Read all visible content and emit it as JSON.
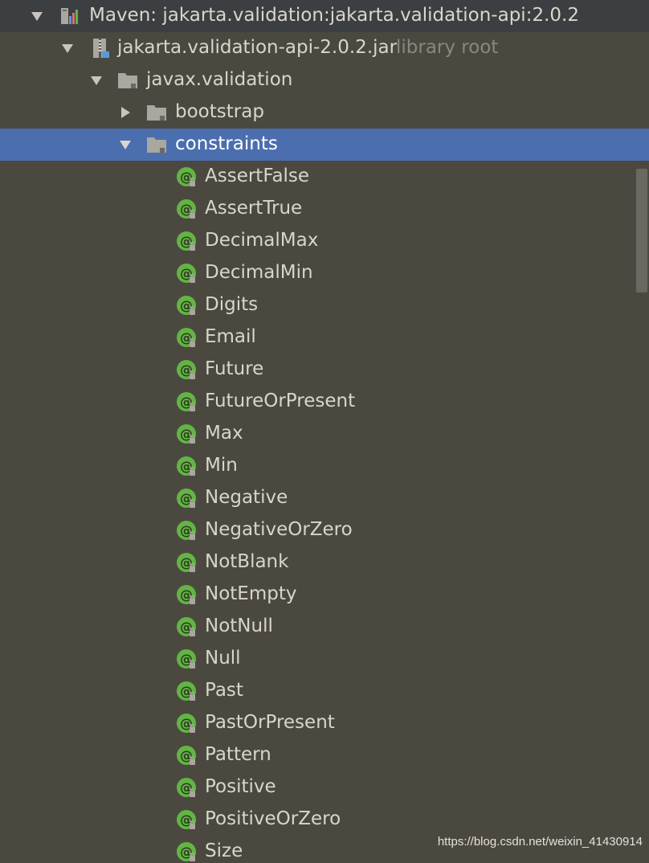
{
  "tree": {
    "root": {
      "label": "Maven: jakarta.validation:jakarta.validation-api:2.0.2",
      "expanded": true
    },
    "jar": {
      "label": "jakarta.validation-api-2.0.2.jar",
      "hint": "library root",
      "expanded": true
    },
    "package": {
      "label": "javax.validation",
      "expanded": true
    },
    "folders": [
      {
        "label": "bootstrap",
        "expanded": false
      },
      {
        "label": "constraints",
        "expanded": true,
        "selected": true
      }
    ],
    "annotations": [
      "AssertFalse",
      "AssertTrue",
      "DecimalMax",
      "DecimalMin",
      "Digits",
      "Email",
      "Future",
      "FutureOrPresent",
      "Max",
      "Min",
      "Negative",
      "NegativeOrZero",
      "NotBlank",
      "NotEmpty",
      "NotNull",
      "Null",
      "Past",
      "PastOrPresent",
      "Pattern",
      "Positive",
      "PositiveOrZero",
      "Size"
    ]
  },
  "icons": {
    "maven": "maven-library-icon",
    "jar": "jar-archive-icon",
    "package": "package-folder-icon",
    "folder": "folder-icon",
    "annotation": "annotation-icon"
  },
  "colors": {
    "background": "#4b4840",
    "selection": "#4b6eaf",
    "annotation_badge": "#62b543",
    "text": "#d8d6cc",
    "hint": "#8a887e"
  },
  "watermark": "https://blog.csdn.net/weixin_41430914"
}
